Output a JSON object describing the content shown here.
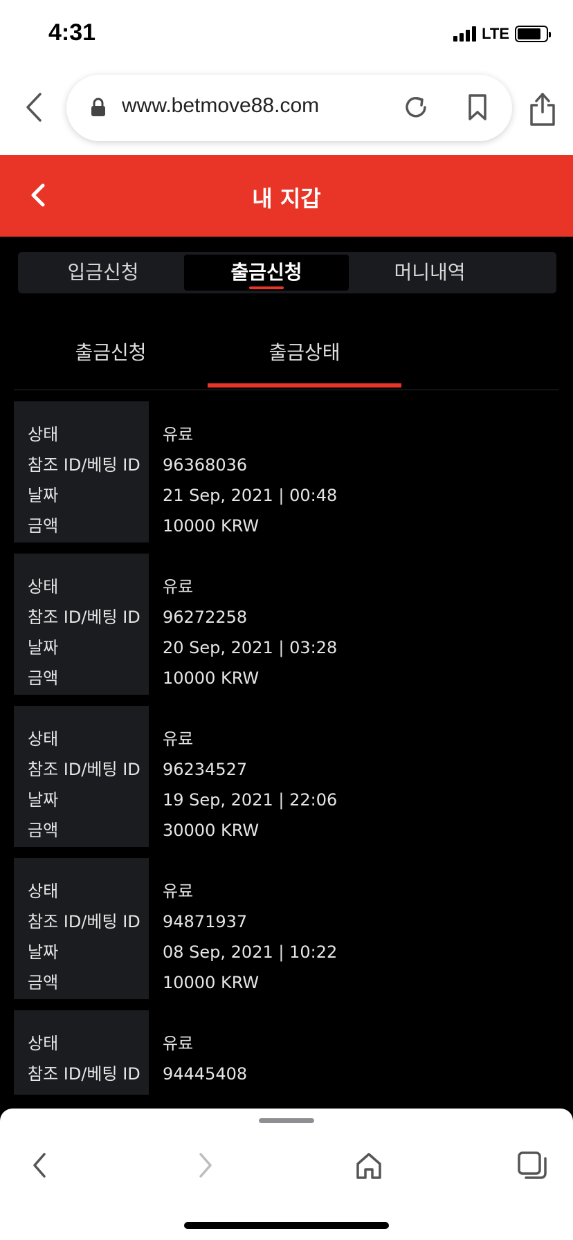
{
  "status_bar": {
    "time": "4:31",
    "network": "LTE"
  },
  "browser": {
    "url": "www.betmove88.com"
  },
  "header": {
    "title": "내 지갑"
  },
  "top_tabs": [
    {
      "label": "입금신청"
    },
    {
      "label": "출금신청"
    },
    {
      "label": "머니내역"
    }
  ],
  "sub_tabs": [
    {
      "label": "출금신청"
    },
    {
      "label": "출금상태"
    }
  ],
  "labels": {
    "status": "상태",
    "ref_id": "참조 ID/베팅 ID",
    "date": "날짜",
    "amount": "금액"
  },
  "records": [
    {
      "status": "유료",
      "ref_id": "96368036",
      "date": "21 Sep, 2021 | 00:48",
      "amount": "10000 KRW"
    },
    {
      "status": "유료",
      "ref_id": "96272258",
      "date": "20 Sep, 2021 | 03:28",
      "amount": "10000 KRW"
    },
    {
      "status": "유료",
      "ref_id": "96234527",
      "date": "19 Sep, 2021 | 22:06",
      "amount": "30000 KRW"
    },
    {
      "status": "유료",
      "ref_id": "94871937",
      "date": "08 Sep, 2021 | 10:22",
      "amount": "10000 KRW"
    },
    {
      "status": "유료",
      "ref_id": "94445408",
      "date": "",
      "amount": ""
    }
  ],
  "colors": {
    "accent": "#e93527",
    "panel": "#1b1c20",
    "background": "#000000"
  }
}
